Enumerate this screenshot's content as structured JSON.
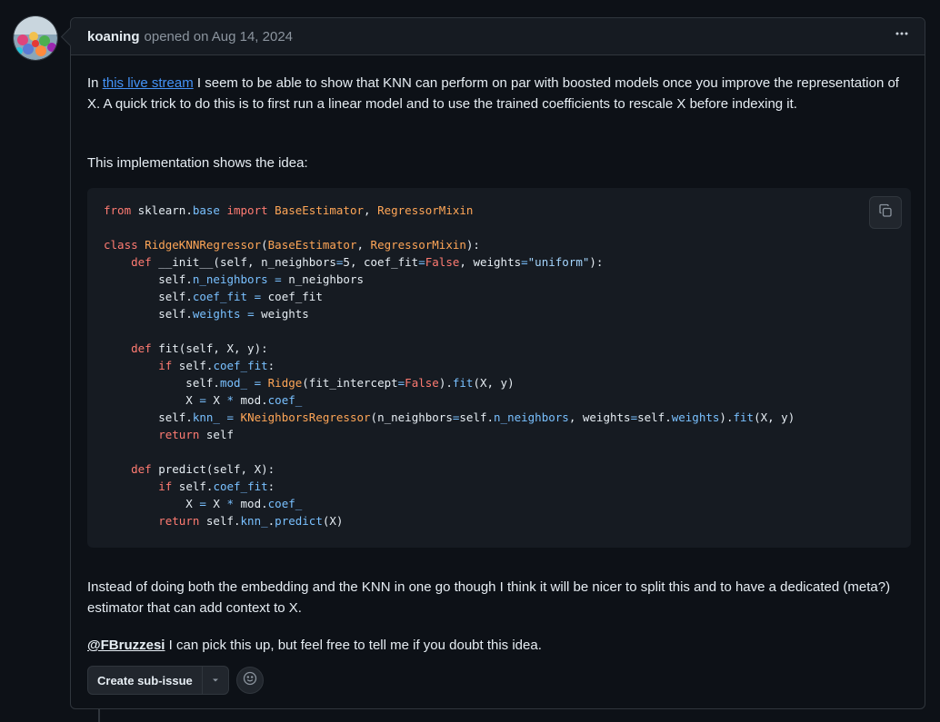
{
  "comment": {
    "author": "koaning",
    "opened_text": "opened on Aug 14, 2024",
    "more_icon": "kebab-horizontal-icon"
  },
  "body": {
    "p1_prefix": "In ",
    "p1_link": "this live stream",
    "p1_suffix": " I seem to be able to show that KNN can perform on par with boosted models once you improve the representation of X. A quick trick to do this is to first run a linear model and to use the trained coefficients to rescale X before indexing it.",
    "p2": "This implementation shows the idea:",
    "p3": "Instead of doing both the embedding and the KNN in one go though I think it will be nicer to split this and to have a dedicated (meta?) estimator that can add context to X.",
    "p4_mention": "@FBruzzesi",
    "p4_suffix": " I can pick this up, but feel free to tell me if you doubt this idea."
  },
  "code": {
    "language": "python",
    "copy_icon": "copy-icon",
    "lines": [
      "from sklearn.base import BaseEstimator, RegressorMixin",
      "",
      "class RidgeKNNRegressor(BaseEstimator, RegressorMixin):",
      "    def __init__(self, n_neighbors=5, coef_fit=False, weights=\"uniform\"):",
      "        self.n_neighbors = n_neighbors",
      "        self.coef_fit = coef_fit",
      "        self.weights = weights",
      "",
      "    def fit(self, X, y):",
      "        if self.coef_fit:",
      "            self.mod_ = Ridge(fit_intercept=False).fit(X, y)",
      "            X = X * mod.coef_",
      "        self.knn_ = KNeighborsRegressor(n_neighbors=self.n_neighbors, weights=self.weights).fit(X, y)",
      "        return self",
      "",
      "    def predict(self, X):",
      "        if self.coef_fit:",
      "            X = X * mod.coef_",
      "        return self.knn_.predict(X)"
    ]
  },
  "actions": {
    "create_sub_issue": "Create sub-issue",
    "caret_icon": "triangle-down-icon",
    "reaction_icon": "smiley-icon"
  },
  "colors": {
    "background": "#0d1117",
    "header": "#161b22",
    "border": "#30363d",
    "link": "#4493f8",
    "keyword": "#ff7b72",
    "class_name": "#ffa657",
    "attribute": "#79c0ff",
    "string": "#a5d6ff"
  }
}
